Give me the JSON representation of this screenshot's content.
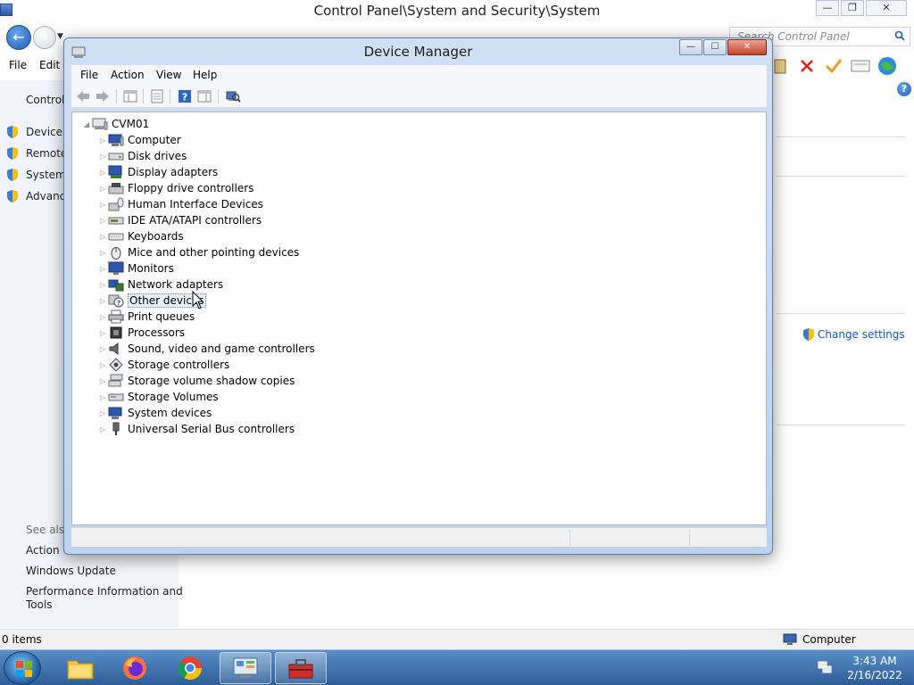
{
  "background_window": {
    "title": "Control Panel\\System and Security\\System",
    "breadcrumb": [
      "Control Panel",
      "System and Security",
      "System"
    ],
    "search_placeholder": "Search Control Panel",
    "menu": [
      "File",
      "Edit"
    ],
    "left_pane": {
      "heading": "Control",
      "items": [
        "Device M",
        "Remote",
        "System",
        "Advanc"
      ],
      "see_also_label": "See also",
      "see_also_items": [
        "Action C",
        "Windows Update",
        "Performance Information and",
        "Tools"
      ]
    },
    "change_settings": "Change settings",
    "status": {
      "items": "0 items",
      "computer": "Computer"
    }
  },
  "device_manager": {
    "title": "Device Manager",
    "menu": [
      "File",
      "Action",
      "View",
      "Help"
    ],
    "root": "CVM01",
    "categories": [
      {
        "label": "Computer",
        "icon": "computer-icon"
      },
      {
        "label": "Disk drives",
        "icon": "disk-drive-icon"
      },
      {
        "label": "Display adapters",
        "icon": "display-adapter-icon"
      },
      {
        "label": "Floppy drive controllers",
        "icon": "floppy-controller-icon"
      },
      {
        "label": "Human Interface Devices",
        "icon": "hid-icon"
      },
      {
        "label": "IDE ATA/ATAPI controllers",
        "icon": "ide-controller-icon"
      },
      {
        "label": "Keyboards",
        "icon": "keyboard-icon"
      },
      {
        "label": "Mice and other pointing devices",
        "icon": "mouse-icon"
      },
      {
        "label": "Monitors",
        "icon": "monitor-icon"
      },
      {
        "label": "Network adapters",
        "icon": "network-adapter-icon"
      },
      {
        "label": "Other devices",
        "icon": "unknown-device-icon",
        "selected": true
      },
      {
        "label": "Print queues",
        "icon": "printer-icon"
      },
      {
        "label": "Processors",
        "icon": "processor-icon"
      },
      {
        "label": "Sound, video and game controllers",
        "icon": "speaker-icon"
      },
      {
        "label": "Storage controllers",
        "icon": "storage-controller-icon"
      },
      {
        "label": "Storage volume shadow copies",
        "icon": "shadow-copy-icon"
      },
      {
        "label": "Storage Volumes",
        "icon": "storage-volume-icon"
      },
      {
        "label": "System devices",
        "icon": "system-device-icon"
      },
      {
        "label": "Universal Serial Bus controllers",
        "icon": "usb-icon"
      }
    ]
  },
  "taskbar": {
    "apps": [
      "file-explorer-icon",
      "firefox-icon",
      "chrome-icon",
      "control-panel-icon",
      "toolbox-icon"
    ],
    "time": "3:43 AM",
    "date": "2/16/2022"
  },
  "colors": {
    "accent": "#1e5fb5",
    "link": "#0f57b8",
    "taskbar": "#2d5d97",
    "close_button": "#c4412b"
  }
}
